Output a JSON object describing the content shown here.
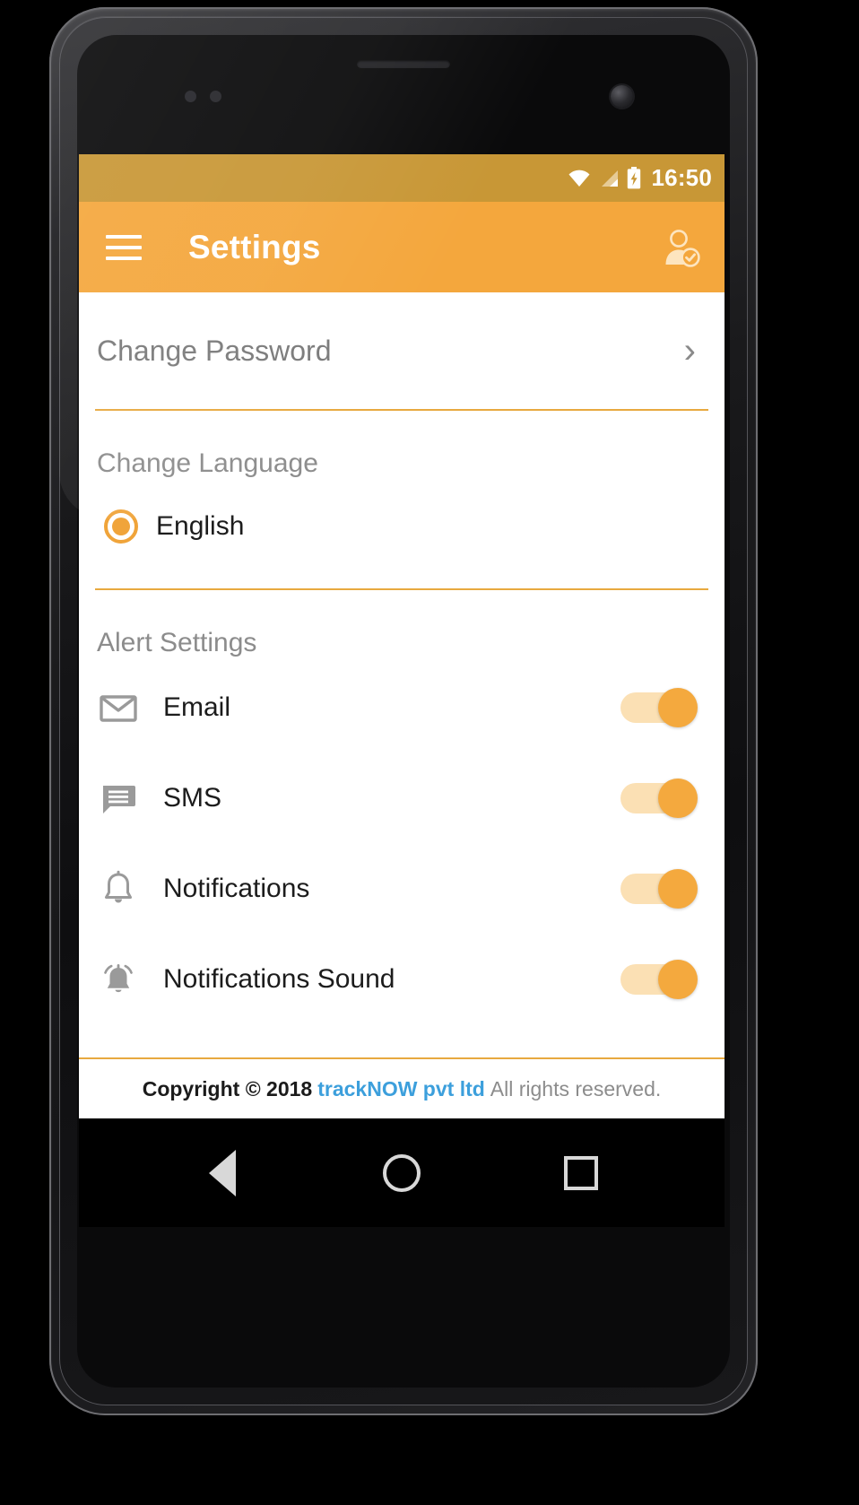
{
  "device": {
    "name": "android-phone",
    "bezel_color": "#1b1b1d"
  },
  "statusbar": {
    "time": "16:50",
    "background": "#c89736",
    "icons": [
      "wifi-icon",
      "cellular-signal-icon",
      "battery-charging-icon"
    ]
  },
  "appbar": {
    "title": "Settings",
    "menu_icon": "hamburger-menu-icon",
    "profile_icon": "user-verified-icon",
    "background": "#f4a73d"
  },
  "content": {
    "change_password": {
      "label": "Change Password",
      "chevron": "›"
    },
    "change_language": {
      "heading": "Change Language",
      "options": [
        {
          "label": "English",
          "selected": true
        }
      ]
    },
    "alert_settings": {
      "heading": "Alert Settings",
      "rows": [
        {
          "label": "Email",
          "icon": "email-icon",
          "enabled": true
        },
        {
          "label": "SMS",
          "icon": "sms-message-icon",
          "enabled": true
        },
        {
          "label": "Notifications",
          "icon": "bell-icon",
          "enabled": true
        },
        {
          "label": "Notifications Sound",
          "icon": "bell-ringing-icon",
          "enabled": true
        }
      ]
    }
  },
  "footer": {
    "copyright": "Copyright © 2018",
    "brand": "trackNOW pvt ltd",
    "rights": "All rights reserved.",
    "brand_color": "#3c9fdc",
    "divider_color": "#e8a93f"
  },
  "navbar": {
    "back": "back-button",
    "home": "home-button",
    "recents": "recents-button"
  },
  "colors": {
    "accent": "#f4a73d",
    "status_bar": "#c89736",
    "switch_track": "#fbe0b4",
    "switch_thumb": "#f4a93e",
    "radio": "#f0a43a"
  }
}
